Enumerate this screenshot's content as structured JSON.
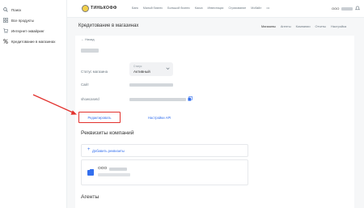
{
  "sidebar": {
    "items": [
      {
        "label": "Поиск",
        "icon": "search-icon"
      },
      {
        "label": "Все продукты",
        "icon": "grid-icon"
      },
      {
        "label": "Интернет-эквайринг",
        "icon": "cart-icon"
      },
      {
        "label": "Кредитование в магазинах",
        "icon": "percent-icon"
      }
    ]
  },
  "topbar": {
    "logo_text": "ТИНЬКОФФ",
    "nav": [
      "Банк",
      "Малый бизнес",
      "Большой бизнес",
      "Касса",
      "Инвестиции",
      "Страхование",
      "Мобайл",
      "•••"
    ],
    "user_prefix": "ООО"
  },
  "header": {
    "title": "Кредитование в магазинах",
    "tabs": [
      "Магазины",
      "Агенты",
      "Компании",
      "Отчеты",
      "Настройка"
    ]
  },
  "main": {
    "back_label": "← Назад",
    "status_label": "Статус магазина",
    "status_select": {
      "caption": "Статус",
      "value": "Активный"
    },
    "site_label": "Сайт",
    "showcase_label": "showcaseId",
    "edit_button": "Редактировать",
    "api_link": "Настройки API",
    "companies_title": "Реквизиты компаний",
    "add_requisites": "Добавить реквизиты",
    "company_prefix": "ООО",
    "agents_title": "Агенты"
  },
  "colors": {
    "accent": "#336fee",
    "highlight": "#e2312d",
    "logo": "#f2d04a"
  }
}
